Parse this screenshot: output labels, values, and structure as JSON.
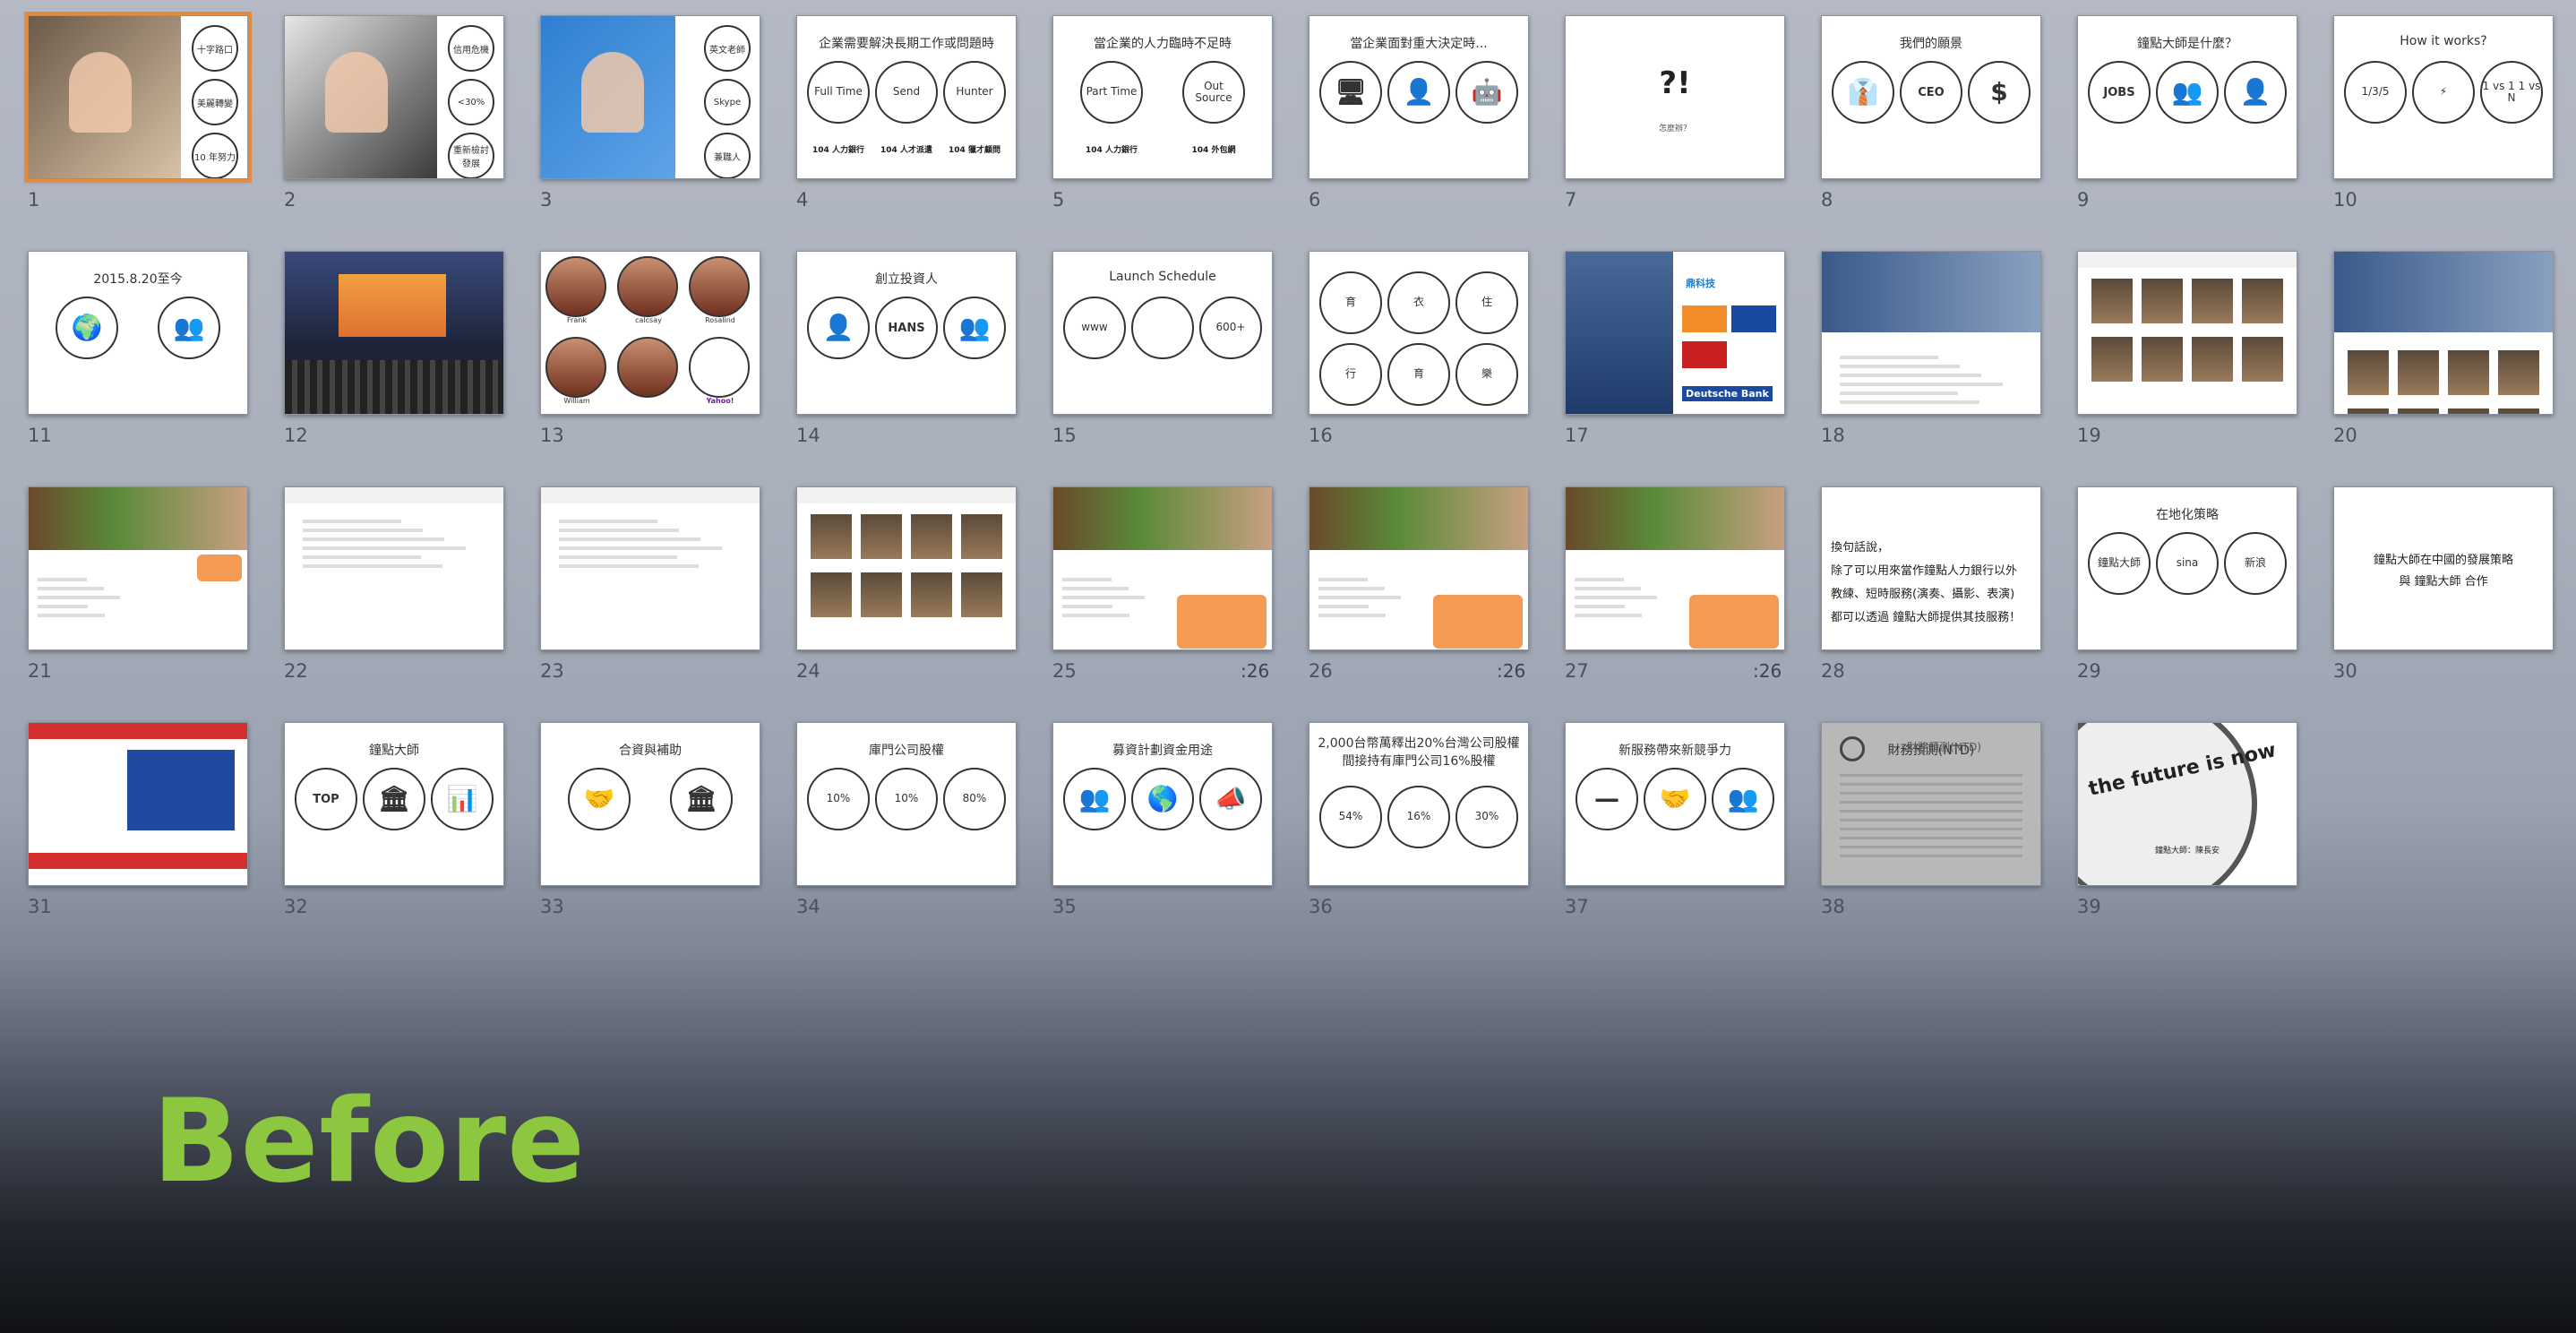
{
  "slides": [
    {
      "n": "1",
      "type": "photo_side",
      "circles": [
        "十字路口",
        "美麗轉變",
        "10 年努力"
      ],
      "selected": true
    },
    {
      "n": "2",
      "type": "photo_side",
      "circles": [
        "信用危機",
        "<30%",
        "重新檢討發展"
      ]
    },
    {
      "n": "3",
      "type": "photo_side",
      "circles": [
        "英文老師",
        "Skype",
        "兼職人"
      ]
    },
    {
      "n": "4",
      "type": "circles",
      "title": "企業需要解決長期工作或問題時",
      "circles": [
        "Full Time",
        "Send",
        "Hunter"
      ],
      "footer": [
        "104 人力銀行",
        "104 人才派遣",
        "104 獵才顧問"
      ]
    },
    {
      "n": "5",
      "type": "circles",
      "title": "當企業的人力臨時不足時",
      "circles": [
        "Part Time",
        "Out Source"
      ],
      "footer": [
        "104 人力銀行",
        "104 外包網"
      ]
    },
    {
      "n": "6",
      "type": "icons",
      "title": "當企業面對重大決定時...",
      "icons": [
        "🖥",
        "👤",
        "🤖"
      ]
    },
    {
      "n": "7",
      "type": "single_icon",
      "icon": "?!",
      "caption": "怎麼辦？"
    },
    {
      "n": "8",
      "type": "icons",
      "title": "我們的願景",
      "icons": [
        "👔",
        "CEO",
        "$"
      ]
    },
    {
      "n": "9",
      "type": "icons",
      "title": "鐘點大師是什麼？",
      "icons": [
        "JOBS",
        "👥",
        "👤"
      ]
    },
    {
      "n": "10",
      "type": "circles",
      "title": "How it works?",
      "circles": [
        "1/3/5",
        "⚡",
        "1 vs 1 1 vs N"
      ]
    },
    {
      "n": "11",
      "type": "icons",
      "title": "2015.8.20至今",
      "icons": [
        "🌍",
        "👥"
      ]
    },
    {
      "n": "12",
      "type": "stage"
    },
    {
      "n": "13",
      "type": "team",
      "names": [
        "Frank",
        "calcsay",
        "Rosalind",
        "William",
        "Yahoo!"
      ]
    },
    {
      "n": "14",
      "type": "icons",
      "title": "創立投資人",
      "icons": [
        "👤",
        "HANS",
        "👥"
      ]
    },
    {
      "n": "15",
      "type": "circles",
      "title": "Launch Schedule",
      "circles": [
        "www",
        "",
        "600+"
      ]
    },
    {
      "n": "16",
      "type": "circles6",
      "circles": [
        "育",
        "衣",
        "住",
        "行",
        "育",
        "樂"
      ]
    },
    {
      "n": "17",
      "type": "sponsor",
      "labels": [
        "鼎科技",
        "Deutsche Bank"
      ]
    },
    {
      "n": "18",
      "type": "web"
    },
    {
      "n": "19",
      "type": "web_grid"
    },
    {
      "n": "20",
      "type": "web_person"
    },
    {
      "n": "21",
      "type": "web_orange"
    },
    {
      "n": "22",
      "type": "web_text"
    },
    {
      "n": "23",
      "type": "web_text"
    },
    {
      "n": "24",
      "type": "web_grid"
    },
    {
      "n": "25",
      "type": "web_orange_note",
      "duration": ":26"
    },
    {
      "n": "26",
      "type": "web_orange_note",
      "duration": ":26"
    },
    {
      "n": "27",
      "type": "web_orange_note",
      "duration": ":26"
    },
    {
      "n": "28",
      "type": "text_block",
      "lines": [
        "換句話說，",
        "除了可以用來當作鐘點人力銀行以外",
        "教練、短時服務(演奏、攝影、表演)",
        "都可以透過 鐘點大師提供其技服務！"
      ]
    },
    {
      "n": "29",
      "type": "circles",
      "title": "在地化策略",
      "circles": [
        "鐘點大師",
        "sina",
        "新浪"
      ]
    },
    {
      "n": "30",
      "type": "text_center",
      "lines": [
        "鐘點大師在中國的發展策略",
        "與 鐘點大師 合作"
      ]
    },
    {
      "n": "31",
      "type": "web_red"
    },
    {
      "n": "32",
      "type": "icons",
      "title": "鐘點大師",
      "icons": [
        "TOP",
        "🏛",
        "📊"
      ]
    },
    {
      "n": "33",
      "type": "icons",
      "title": "合資與補助",
      "icons": [
        "🤝",
        "🏛"
      ]
    },
    {
      "n": "34",
      "type": "circles",
      "title": "庫門公司股權",
      "circles": [
        "10%",
        "10%",
        "80%"
      ]
    },
    {
      "n": "35",
      "type": "icons",
      "title": "募資計劃資金用途",
      "icons": [
        "👥",
        "🌎",
        "📣"
      ]
    },
    {
      "n": "36",
      "type": "circles",
      "title": "2,000台幣萬釋出20%台灣公司股權",
      "subtitle": "間接持有庫門公司16%股權",
      "circles": [
        "54%",
        "16%",
        "30%"
      ]
    },
    {
      "n": "37",
      "type": "icons",
      "title": "新服務帶來新競爭力",
      "icons": [
        "—",
        "🤝",
        "👥"
      ]
    },
    {
      "n": "38",
      "type": "table",
      "title": "財務預測(NTD)"
    },
    {
      "n": "39",
      "type": "clock",
      "text": "the future is now",
      "caption": "鐘點大師：陳長安"
    }
  ],
  "before_label": "Before"
}
